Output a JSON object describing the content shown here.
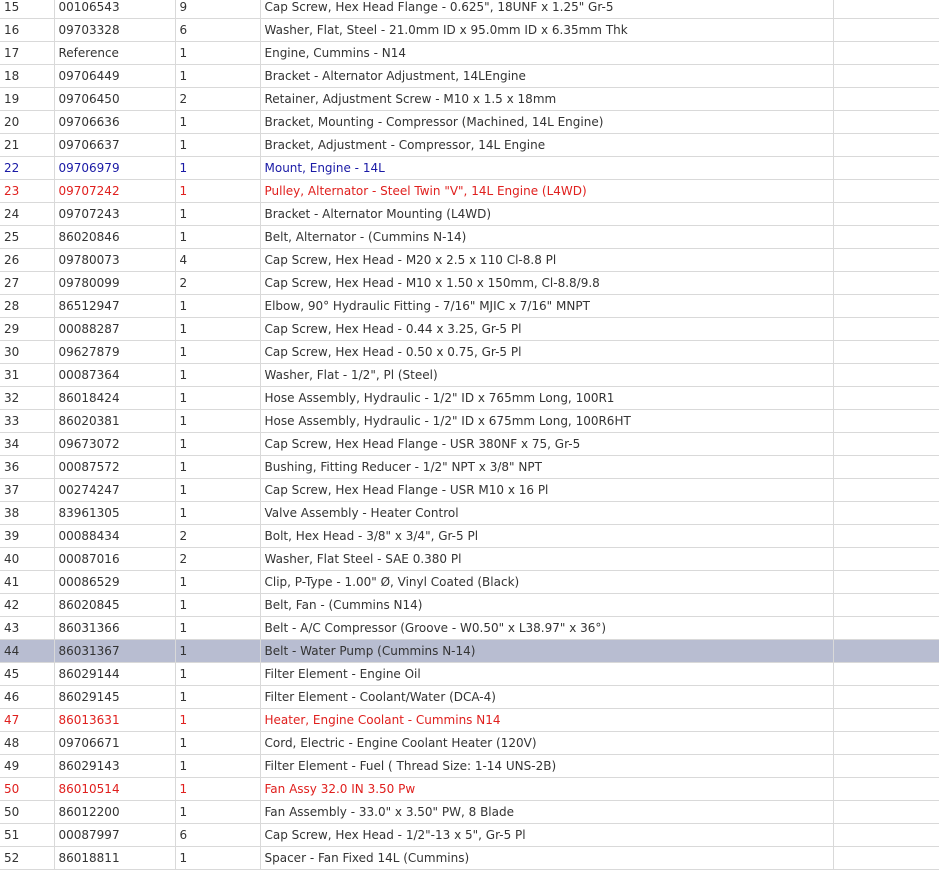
{
  "colors": {
    "text_default": "#333333",
    "text_blue": "#1a1aa6",
    "text_red": "#e0201e",
    "selected_row_background": "#b8bdd1",
    "grid_line": "#d9d9d9"
  },
  "rows": [
    {
      "item": "15",
      "part": "00106543",
      "qty": "9",
      "desc": "Cap Screw, Hex Head Flange - 0.625\", 18UNF x 1.25\" Gr-5",
      "style": "normal"
    },
    {
      "item": "16",
      "part": "09703328",
      "qty": "6",
      "desc": "Washer, Flat, Steel - 21.0mm ID x 95.0mm ID x 6.35mm Thk",
      "style": "normal"
    },
    {
      "item": "17",
      "part": "Reference",
      "qty": "1",
      "desc": "Engine, Cummins - N14",
      "style": "normal"
    },
    {
      "item": "18",
      "part": "09706449",
      "qty": "1",
      "desc": "Bracket - Alternator Adjustment, 14LEngine",
      "style": "normal"
    },
    {
      "item": "19",
      "part": "09706450",
      "qty": "2",
      "desc": "Retainer, Adjustment Screw - M10 x 1.5 x 18mm",
      "style": "normal"
    },
    {
      "item": "20",
      "part": "09706636",
      "qty": "1",
      "desc": "Bracket, Mounting - Compressor (Machined, 14L Engine)",
      "style": "normal"
    },
    {
      "item": "21",
      "part": "09706637",
      "qty": "1",
      "desc": "Bracket, Adjustment - Compressor, 14L Engine",
      "style": "normal"
    },
    {
      "item": "22",
      "part": "09706979",
      "qty": "1",
      "desc": "Mount, Engine - 14L",
      "style": "blue"
    },
    {
      "item": "23",
      "part": "09707242",
      "qty": "1",
      "desc": "Pulley, Alternator - Steel Twin \"V\", 14L Engine (L4WD)",
      "style": "red"
    },
    {
      "item": "24",
      "part": "09707243",
      "qty": "1",
      "desc": "Bracket - Alternator Mounting (L4WD)",
      "style": "normal"
    },
    {
      "item": "25",
      "part": "86020846",
      "qty": "1",
      "desc": "Belt, Alternator - (Cummins N-14)",
      "style": "normal"
    },
    {
      "item": "26",
      "part": "09780073",
      "qty": "4",
      "desc": "Cap Screw, Hex Head - M20 x 2.5 x 110 Cl-8.8 Pl",
      "style": "normal"
    },
    {
      "item": "27",
      "part": "09780099",
      "qty": "2",
      "desc": "Cap Screw, Hex Head - M10 x 1.50 x 150mm, Cl-8.8/9.8",
      "style": "normal"
    },
    {
      "item": "28",
      "part": "86512947",
      "qty": "1",
      "desc": "Elbow, 90° Hydraulic Fitting - 7/16\" MJIC x 7/16\" MNPT",
      "style": "normal"
    },
    {
      "item": "29",
      "part": "00088287",
      "qty": "1",
      "desc": "Cap Screw, Hex Head - 0.44 x 3.25, Gr-5 Pl",
      "style": "normal"
    },
    {
      "item": "30",
      "part": "09627879",
      "qty": "1",
      "desc": "Cap Screw, Hex Head - 0.50 x 0.75, Gr-5 Pl",
      "style": "normal"
    },
    {
      "item": "31",
      "part": "00087364",
      "qty": "1",
      "desc": "Washer, Flat - 1/2\", Pl (Steel)",
      "style": "normal"
    },
    {
      "item": "32",
      "part": "86018424",
      "qty": "1",
      "desc": "Hose Assembly, Hydraulic - 1/2\" ID x 765mm Long, 100R1",
      "style": "normal"
    },
    {
      "item": "33",
      "part": "86020381",
      "qty": "1",
      "desc": "Hose Assembly, Hydraulic - 1/2\" ID x 675mm Long, 100R6HT",
      "style": "normal"
    },
    {
      "item": "34",
      "part": "09673072",
      "qty": "1",
      "desc": "Cap Screw, Hex Head Flange - USR 380NF x 75, Gr-5",
      "style": "normal"
    },
    {
      "item": "36",
      "part": "00087572",
      "qty": "1",
      "desc": "Bushing, Fitting Reducer - 1/2\" NPT x 3/8\" NPT",
      "style": "normal"
    },
    {
      "item": "37",
      "part": "00274247",
      "qty": "1",
      "desc": "Cap Screw, Hex Head Flange - USR M10 x 16 Pl",
      "style": "normal"
    },
    {
      "item": "38",
      "part": "83961305",
      "qty": "1",
      "desc": "Valve Assembly - Heater Control",
      "style": "normal"
    },
    {
      "item": "39",
      "part": "00088434",
      "qty": "2",
      "desc": "Bolt, Hex Head - 3/8\" x 3/4\", Gr-5 Pl",
      "style": "normal"
    },
    {
      "item": "40",
      "part": "00087016",
      "qty": "2",
      "desc": "Washer, Flat Steel - SAE 0.380 Pl",
      "style": "normal"
    },
    {
      "item": "41",
      "part": "00086529",
      "qty": "1",
      "desc": "Clip, P-Type - 1.00\" Ø, Vinyl Coated (Black)",
      "style": "normal"
    },
    {
      "item": "42",
      "part": "86020845",
      "qty": "1",
      "desc": "Belt, Fan - (Cummins N14)",
      "style": "normal"
    },
    {
      "item": "43",
      "part": "86031366",
      "qty": "1",
      "desc": "Belt - A/C Compressor (Groove - W0.50\" x L38.97\" x 36°)",
      "style": "normal"
    },
    {
      "item": "44",
      "part": "86031367",
      "qty": "1",
      "desc": "Belt - Water Pump (Cummins N-14)",
      "style": "selected"
    },
    {
      "item": "45",
      "part": "86029144",
      "qty": "1",
      "desc": "Filter Element - Engine Oil",
      "style": "normal"
    },
    {
      "item": "46",
      "part": "86029145",
      "qty": "1",
      "desc": "Filter Element - Coolant/Water (DCA-4)",
      "style": "normal"
    },
    {
      "item": "47",
      "part": "86013631",
      "qty": "1",
      "desc": "Heater, Engine Coolant - Cummins N14",
      "style": "red"
    },
    {
      "item": "48",
      "part": "09706671",
      "qty": "1",
      "desc": "Cord, Electric - Engine Coolant Heater (120V)",
      "style": "normal"
    },
    {
      "item": "49",
      "part": "86029143",
      "qty": "1",
      "desc": "Filter Element - Fuel ( Thread Size: 1-14 UNS-2B)",
      "style": "normal"
    },
    {
      "item": "50",
      "part": "86010514",
      "qty": "1",
      "desc": "Fan Assy 32.0 IN 3.50 Pw",
      "style": "red"
    },
    {
      "item": "50",
      "part": "86012200",
      "qty": "1",
      "desc": "Fan Assembly - 33.0\" x 3.50\" PW, 8 Blade",
      "style": "normal"
    },
    {
      "item": "51",
      "part": "00087997",
      "qty": "6",
      "desc": "Cap Screw, Hex Head - 1/2\"-13 x 5\", Gr-5 Pl",
      "style": "normal"
    },
    {
      "item": "52",
      "part": "86018811",
      "qty": "1",
      "desc": "Spacer - Fan Fixed 14L (Cummins)",
      "style": "normal"
    }
  ]
}
